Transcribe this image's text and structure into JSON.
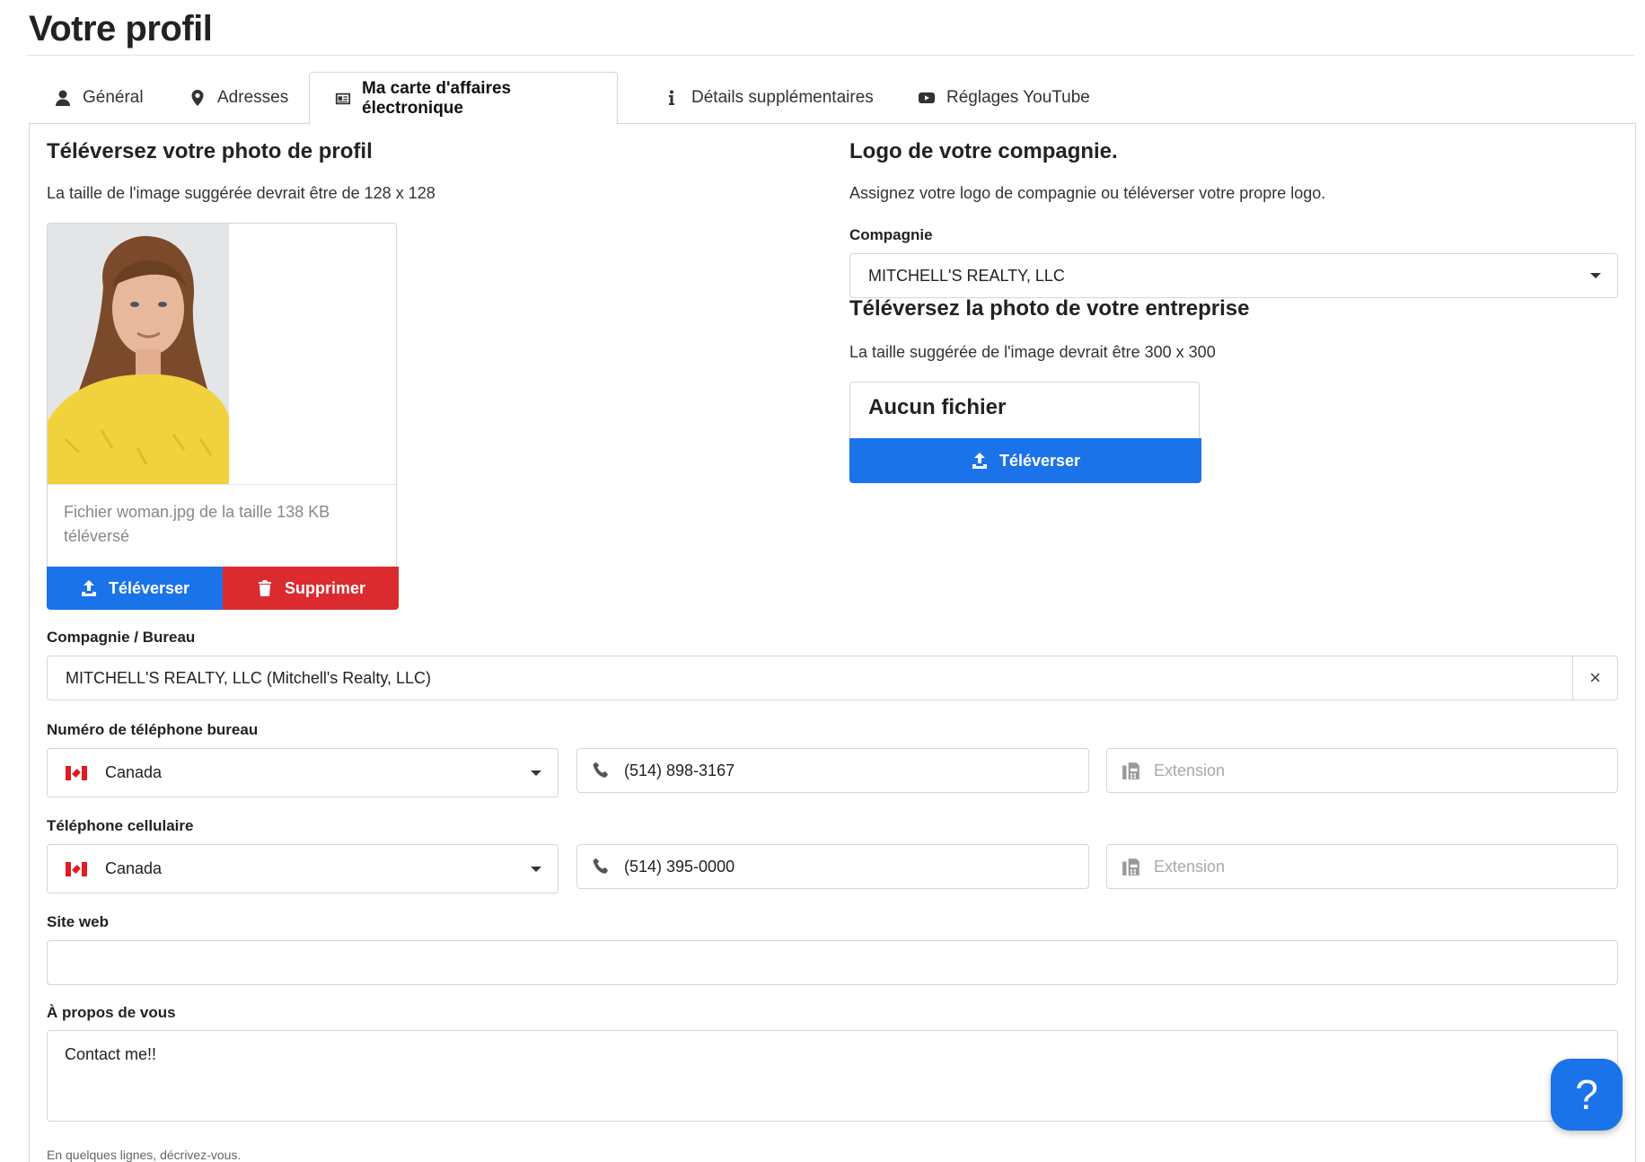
{
  "page_title": "Votre profil",
  "tabs": [
    {
      "label": "Général",
      "icon": "user-icon"
    },
    {
      "label": "Adresses",
      "icon": "map-marker-icon"
    },
    {
      "label": "Ma carte d'affaires électronique",
      "icon": "id-card-icon",
      "active": true
    },
    {
      "label": "Détails supplémentaires",
      "icon": "info-icon"
    },
    {
      "label": "Réglages YouTube",
      "icon": "youtube-icon"
    }
  ],
  "profile_photo": {
    "heading": "Téléversez votre photo de profil",
    "help": "La taille de l'image suggérée devrait être de 128 x 128",
    "caption": "Fichier woman.jpg de la taille 138 KB téléversé",
    "upload_label": "Téléverser",
    "delete_label": "Supprimer"
  },
  "company_logo": {
    "heading": "Logo de votre compagnie.",
    "help": "Assignez votre logo de compagnie ou téléverser votre propre logo.",
    "company_label": "Compagnie",
    "company_value": "MITCHELL'S REALTY, LLC",
    "upload_heading": "Téléversez la photo de votre entreprise",
    "upload_help": "La taille suggérée de l'image devrait être 300 x 300",
    "no_file": "Aucun fichier",
    "upload_label": "Téléverser"
  },
  "office": {
    "label": "Compagnie / Bureau",
    "value": "MITCHELL'S REALTY, LLC (Mitchell's Realty, LLC)",
    "clear": "×"
  },
  "office_phone": {
    "label": "Numéro de téléphone bureau",
    "country": "Canada",
    "number": "(514) 898-3167",
    "extension_placeholder": "Extension"
  },
  "cell_phone": {
    "label": "Téléphone cellulaire",
    "country": "Canada",
    "number": "(514) 395-0000",
    "extension_placeholder": "Extension"
  },
  "website": {
    "label": "Site web",
    "value": ""
  },
  "about": {
    "label": "À propos de vous",
    "value": "Contact me!!",
    "help": "En quelques lignes, décrivez-vous."
  },
  "help_button": "?",
  "colors": {
    "primary": "#1a73e8",
    "danger": "#db2b2f",
    "border": "#d6d6d6"
  }
}
